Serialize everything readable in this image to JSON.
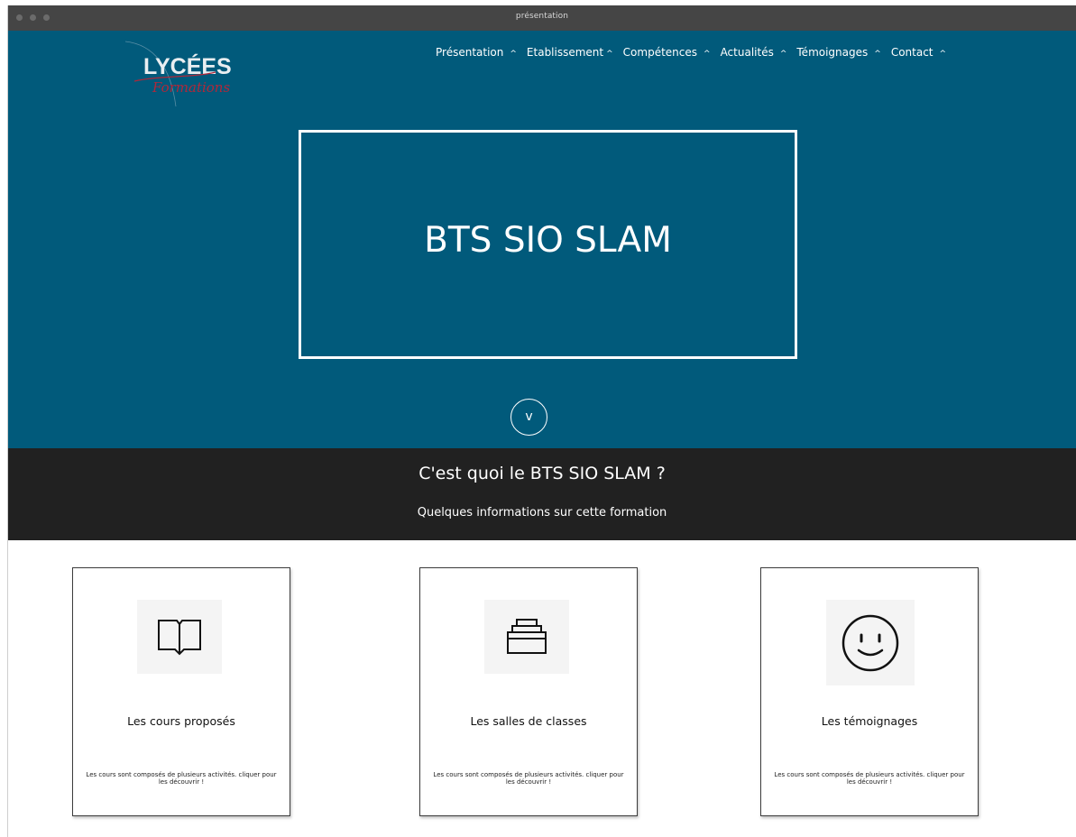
{
  "window": {
    "title": "présentation"
  },
  "header": {
    "logo": {
      "text": "LYCÉES",
      "script": "Formations"
    },
    "nav": [
      {
        "label": "Présentation",
        "caret": "^"
      },
      {
        "label": "Etablissement",
        "caret": "^"
      },
      {
        "label": "Compétences",
        "caret": "^"
      },
      {
        "label": "Actualités",
        "caret": "^"
      },
      {
        "label": "Témoignages",
        "caret": "^"
      },
      {
        "label": "Contact",
        "caret": "^"
      }
    ]
  },
  "hero": {
    "title": "BTS SIO SLAM",
    "scroll_label": "v"
  },
  "section": {
    "title": "C'est quoi le BTS SIO SLAM ?",
    "subtitle": "Quelques informations sur cette formation"
  },
  "cards": [
    {
      "icon": "open-book-icon",
      "title": "Les cours proposés",
      "description": "Les cours sont composés de plusieurs activités. cliquer pour les découvrir !"
    },
    {
      "icon": "stacked-trays-icon",
      "title": "Les salles de classes",
      "description": "Les cours sont composés de plusieurs activités. cliquer pour les découvrir !"
    },
    {
      "icon": "smiley-face-icon",
      "title": "Les témoignages",
      "description": "Les cours sont composés de plusieurs activités. cliquer pour les découvrir !"
    }
  ],
  "colors": {
    "hero_bg": "#015a7b",
    "band_bg": "#212121",
    "titlebar_bg": "#454545",
    "logo_accent": "#b0283a"
  }
}
